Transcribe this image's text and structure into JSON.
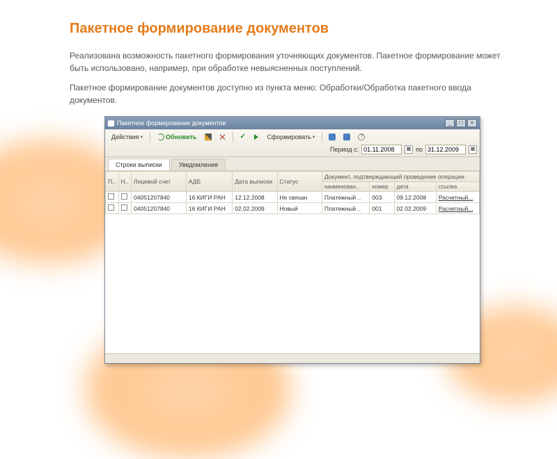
{
  "page": {
    "title": "Пакетное формирование документов",
    "para1": "Реализована возможность пакетного формирования уточняющих документов. Пакетное формирование может быть использовано, например, при обработке невыясненных поступлений.",
    "para2": "Пакетное формирование документов доступно из пункта меню: Обработки/Обработка пакетного ввода документов."
  },
  "window": {
    "title": "Пакетное формирование документов",
    "toolbar": {
      "actions": "Действия",
      "refresh": "Обновить",
      "form": "Сформировать",
      "period_label": "Период с:",
      "date_from": "01.11.2008",
      "date_sep": "по",
      "date_to": "31.12.2009"
    },
    "tabs": {
      "t1": "Строки выписки",
      "t2": "Уведомления"
    },
    "grid": {
      "h_p": "П..",
      "h_n": "Н..",
      "h_acct": "Лицевой счет",
      "h_adb": "АДБ",
      "h_date": "Дата выписки",
      "h_status": "Статус",
      "h_doc": "Документ, подтверждающий проведение операции",
      "h_dname": "наименован..",
      "h_dnum": "номер",
      "h_ddate": "дата",
      "h_dlink": "ссылка",
      "rows": [
        {
          "acct": "04051207840",
          "adb": "16 КИГИ РАН",
          "date": "12.12.2008",
          "status": "Не связан",
          "dname": "Платежный ..",
          "dnum": "003",
          "ddate": "09.12.2008",
          "dlink": "Расчетный..."
        },
        {
          "acct": "04051207840",
          "adb": "16 КИГИ РАН",
          "date": "02.02.2009",
          "status": "Новый",
          "dname": "Платежный ..",
          "dnum": "001",
          "ddate": "02.02.2009",
          "dlink": "Расчетный..."
        }
      ]
    }
  }
}
